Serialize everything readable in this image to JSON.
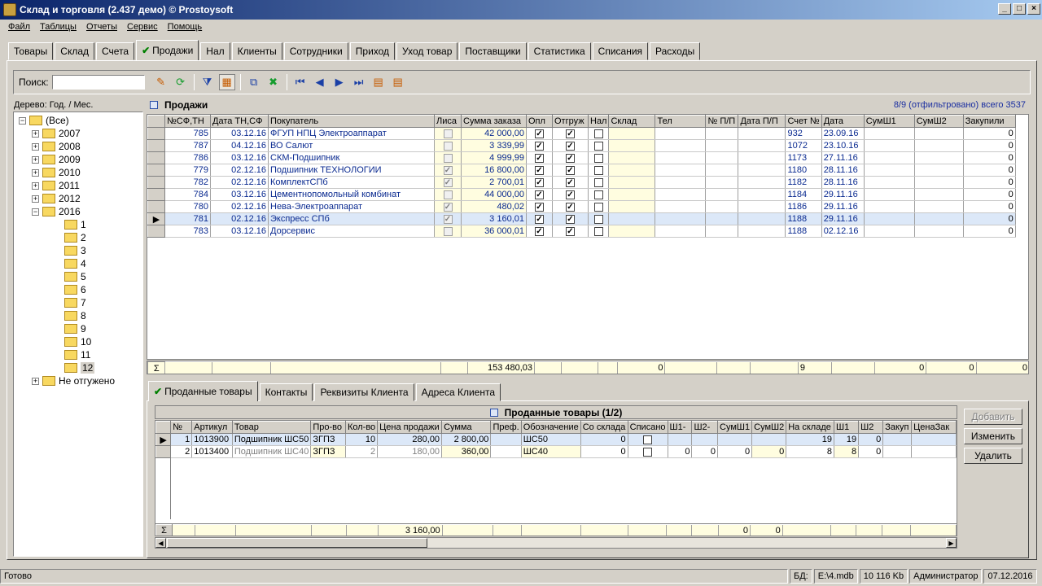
{
  "window": {
    "title": "Склад и торговля (2.437 демо) © Prostoysoft"
  },
  "menu": [
    "Файл",
    "Таблицы",
    "Отчеты",
    "Сервис",
    "Помощь"
  ],
  "tabs": [
    "Товары",
    "Склад",
    "Счета",
    "Продажи",
    "Нал",
    "Клиенты",
    "Сотрудники",
    "Приход",
    "Уход товар",
    "Поставщики",
    "Статистика",
    "Списания",
    "Расходы"
  ],
  "toolbar": {
    "search_label": "Поиск:",
    "search_value": ""
  },
  "tree": {
    "label": "Дерево: Год. / Мес.",
    "root": "(Все)",
    "years": [
      "2007",
      "2008",
      "2009",
      "2010",
      "2011",
      "2012",
      "2016"
    ],
    "months": [
      "1",
      "2",
      "3",
      "4",
      "5",
      "6",
      "7",
      "8",
      "9",
      "10",
      "11",
      "12"
    ],
    "notshipped": "Не отгужено"
  },
  "sales": {
    "title": "Продажи",
    "filter_info": "8/9 (отфильтровано) всего 3537",
    "columns": [
      "№СФ,ТН",
      "Дата ТН,СФ",
      "Покупатель",
      "Лиса",
      "Сумма заказа",
      "Опл",
      "Отгруж",
      "Нал",
      "Склад",
      "Тел",
      "№ П/П",
      "Дата П/П",
      "Счет №",
      "Дата",
      "СумШ1",
      "СумШ2",
      "Закупили"
    ],
    "rows": [
      {
        "n": "785",
        "d": "03.12.16",
        "c": "ФГУП НПЦ Электроаппарат",
        "s": "42 000,00",
        "inv": "932",
        "dt": "23.09.16",
        "z": "0",
        "lisa": false
      },
      {
        "n": "787",
        "d": "04.12.16",
        "c": "ВО Салют",
        "s": "3 339,99",
        "inv": "1072",
        "dt": "23.10.16",
        "z": "0",
        "lisa": false
      },
      {
        "n": "786",
        "d": "03.12.16",
        "c": "СКМ-Подшипник",
        "s": "4 999,99",
        "inv": "1173",
        "dt": "27.11.16",
        "z": "0",
        "lisa": false
      },
      {
        "n": "779",
        "d": "02.12.16",
        "c": "Подшипник ТЕХНОЛОГИИ",
        "s": "16 800,00",
        "inv": "1180",
        "dt": "28.11.16",
        "z": "0",
        "lisa": true
      },
      {
        "n": "782",
        "d": "02.12.16",
        "c": "КомплектСПб",
        "s": "2 700,01",
        "inv": "1182",
        "dt": "28.11.16",
        "z": "0",
        "lisa": true
      },
      {
        "n": "784",
        "d": "03.12.16",
        "c": "Цементнопомольный комбинат",
        "s": "44 000,00",
        "inv": "1184",
        "dt": "29.11.16",
        "z": "0",
        "lisa": false
      },
      {
        "n": "780",
        "d": "02.12.16",
        "c": "Нева-Электроаппарат",
        "s": "480,02",
        "inv": "1186",
        "dt": "29.11.16",
        "z": "0",
        "lisa": true
      },
      {
        "n": "781",
        "d": "02.12.16",
        "c": "Экспресс СПб",
        "s": "3 160,01",
        "inv": "1188",
        "dt": "29.11.16",
        "z": "0",
        "lisa": true
      },
      {
        "n": "783",
        "d": "03.12.16",
        "c": "Дорсервис",
        "s": "36 000,01",
        "inv": "1188",
        "dt": "02.12.16",
        "z": "0",
        "lisa": false
      }
    ],
    "totals": {
      "sum": "153 480,03",
      "sklad": "0",
      "inv": "9",
      "sh1": "0",
      "sh2": "0",
      "z": "0"
    }
  },
  "bottom_tabs": [
    "Проданные товары",
    "Контакты",
    "Реквизиты Клиента",
    "Адреса Клиента"
  ],
  "sold": {
    "title": "Проданные товары (1/2)",
    "columns": [
      "№",
      "Артикул",
      "Товар",
      "Про-во",
      "Кол-во",
      "Цена продажи",
      "Сумма",
      "Преф.",
      "Обозначение",
      "Со склада",
      "Списано",
      "Ш1-",
      "Ш2-",
      "СумШ1",
      "СумШ2",
      "На складе",
      "Ш1",
      "Ш2",
      "Закуп",
      "ЦенаЗак"
    ],
    "rows": [
      {
        "n": "1",
        "a": "1013900",
        "t": "Подшипник ШС50",
        "p": "ЗГПЗ",
        "q": "10",
        "price": "280,00",
        "sum": "2 800,00",
        "o": "ШС50",
        "from": "0",
        "w1": "",
        "w2": "",
        "s1": "",
        "s2": "",
        "stock": "19",
        "h1": "19",
        "h2": "0"
      },
      {
        "n": "2",
        "a": "1013400",
        "t": "Подшипник ШС40",
        "p": "ЗГПЗ",
        "q": "2",
        "price": "180,00",
        "sum": "360,00",
        "o": "ШС40",
        "from": "0",
        "w1": "0",
        "w2": "0",
        "s1": "0",
        "s2": "0",
        "stock": "8",
        "h1": "8",
        "h2": "0"
      }
    ],
    "totals": {
      "sum": "3 160,00",
      "s1": "0",
      "s2": "0"
    }
  },
  "buttons": {
    "add": "Добавить",
    "edit": "Изменить",
    "delete": "Удалить"
  },
  "status": {
    "ready": "Готово",
    "db_label": "БД:",
    "db": "E:\\4.mdb",
    "size": "10 116 Kb",
    "user": "Администратор",
    "date": "07.12.2016"
  }
}
